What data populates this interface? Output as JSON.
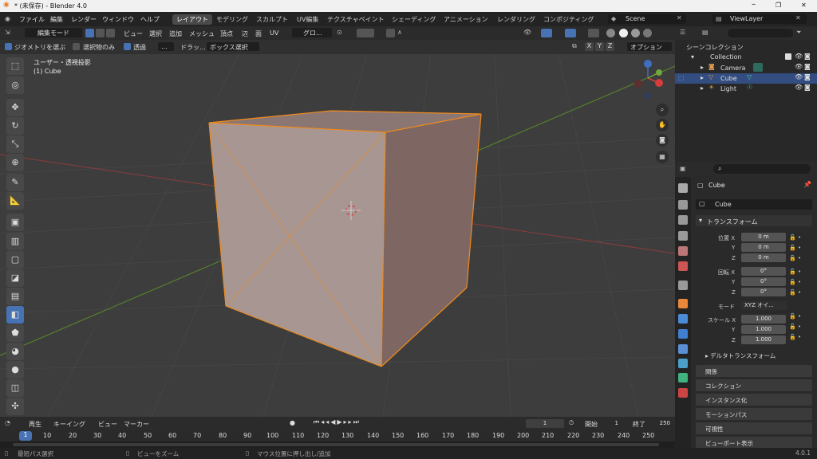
{
  "window": {
    "title": "* (未保存) - Blender 4.0"
  },
  "menu": [
    "ファイル",
    "編集",
    "レンダー",
    "ウィンドウ",
    "ヘルプ"
  ],
  "workspaces": [
    "レイアウト",
    "モデリング",
    "スカルプト",
    "UV編集",
    "テクスチャペイント",
    "シェーディング",
    "アニメーション",
    "レンダリング",
    "コンポジティング"
  ],
  "scene_name": "Scene",
  "view_layer": "ViewLayer",
  "viewport_header": {
    "mode": "編集モード",
    "menus": [
      "ビュー",
      "選択",
      "追加",
      "メッシュ",
      "頂点",
      "辺",
      "面",
      "UV"
    ],
    "orientation": "グロ..."
  },
  "toolsettings": {
    "x_ray_checkbox": "ジオメトリを選ぶ",
    "selected_only": "選択物のみ",
    "transparent": "透過",
    "dragger": "...",
    "drag_label": "ドラッ...",
    "box_select": "ボックス選択",
    "axes": [
      "X",
      "Y",
      "Z"
    ],
    "options": "オプション"
  },
  "viewport_info": {
    "line1": "ユーザー・透視投影",
    "line2": "(1) Cube"
  },
  "outliner": {
    "title": "シーンコレクション",
    "collection": "Collection",
    "items": [
      "Camera",
      "Cube",
      "Light"
    ]
  },
  "properties": {
    "object_name": "Cube",
    "data_name": "Cube",
    "transform_title": "トランスフォーム",
    "location_label": "位置 X",
    "location": [
      "0 m",
      "0 m",
      "0 m"
    ],
    "rotation_label": "回転 X",
    "rotation": [
      "0°",
      "0°",
      "0°"
    ],
    "mode_label": "モード",
    "mode_value": "XYZ オイ...",
    "scale_label": "スケール X",
    "scale": [
      "1.000",
      "1.000",
      "1.000"
    ],
    "axis_y": "Y",
    "axis_z": "Z",
    "delta": "デルタトランスフォーム",
    "sections": [
      "関係",
      "コレクション",
      "インスタンス化",
      "モーションパス",
      "可視性",
      "ビューポート表示"
    ]
  },
  "timeline": {
    "playback": "再生",
    "keying": "キーイング",
    "view": "ビュー",
    "marker": "マーカー",
    "current_frame": "1",
    "start_label": "開始",
    "start": "1",
    "end_label": "終了",
    "end": "250"
  },
  "ruler": [
    "1",
    "10",
    "20",
    "30",
    "40",
    "50",
    "60",
    "70",
    "80",
    "90",
    "100",
    "110",
    "120",
    "130",
    "140",
    "150",
    "160",
    "170",
    "180",
    "190",
    "200",
    "210",
    "220",
    "230",
    "240",
    "250"
  ],
  "status": {
    "left": "最短パス選択",
    "mid": "ビューをズーム",
    "right": "マウス位置に押し出し/追加",
    "version": "4.0.1"
  }
}
